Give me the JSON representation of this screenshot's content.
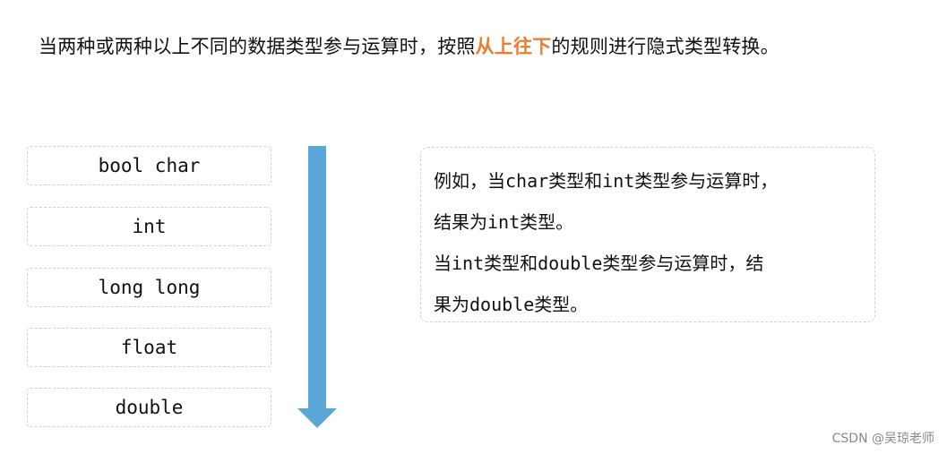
{
  "headline": {
    "before": "当两种或两种以上不同的数据类型参与运算时，按照",
    "highlight": "从上往下",
    "after": "的规则进行隐式类型转换。",
    "highlight_color": "#ed7d31"
  },
  "type_order": {
    "items": [
      "bool char",
      "int",
      "long long",
      "float",
      "double"
    ],
    "direction": "top-to-bottom",
    "arrow_color": "#5ba7d8",
    "box_border_color": "#bdd7ee"
  },
  "example": {
    "lines": [
      "例如，当char类型和int类型参与运算时，",
      "结果为int类型。",
      "当int类型和double类型参与运算时，结",
      "果为double类型。"
    ]
  },
  "watermark": "CSDN @吴琼老师"
}
